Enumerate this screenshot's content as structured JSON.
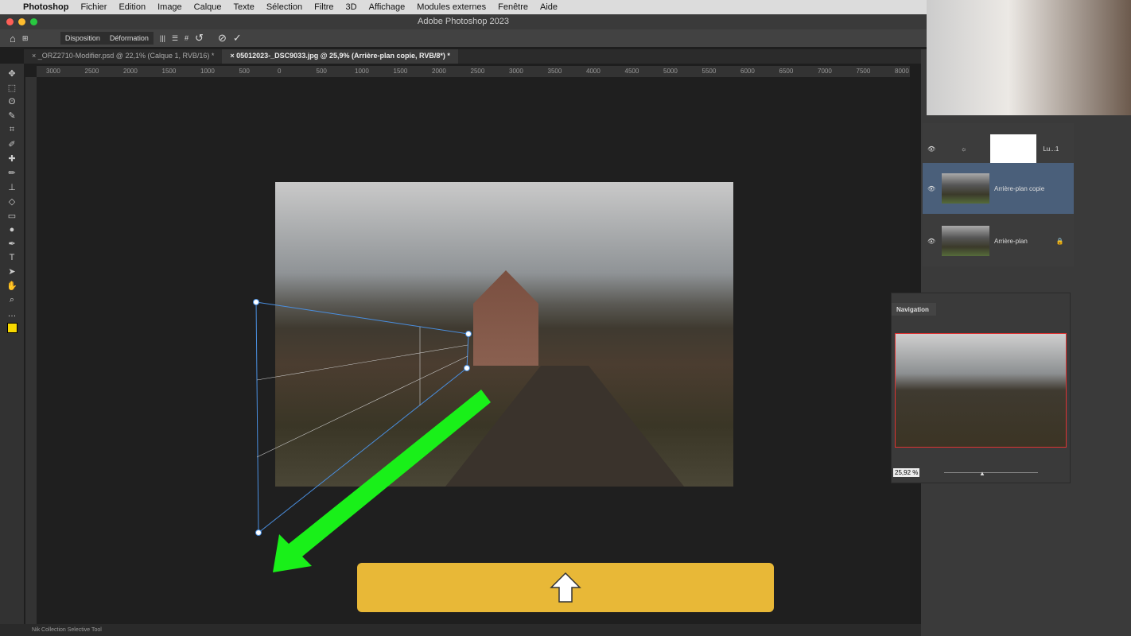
{
  "menubar": {
    "app": "Photoshop",
    "items": [
      "Fichier",
      "Edition",
      "Image",
      "Calque",
      "Texte",
      "Sélection",
      "Filtre",
      "3D",
      "Affichage",
      "Modules externes",
      "Fenêtre",
      "Aide"
    ]
  },
  "window": {
    "title": "Adobe Photoshop 2023"
  },
  "options": {
    "disposition": "Disposition",
    "deformation": "Déformation"
  },
  "tabs": [
    {
      "label": "_ORZ2710-Modifier.psd @ 22,1% (Calque 1, RVB/16) *"
    },
    {
      "label": "05012023-_DSC9033.jpg @ 25,9% (Arrière-plan copie, RVB/8*) *"
    }
  ],
  "ruler": [
    "3000",
    "2500",
    "2000",
    "1500",
    "1000",
    "500",
    "0",
    "500",
    "1000",
    "1500",
    "2000",
    "2500",
    "3000",
    "3500",
    "4000",
    "4500",
    "5000",
    "5500",
    "6000",
    "6500",
    "7000",
    "7500",
    "8000"
  ],
  "layers": [
    {
      "name": "Lu...1"
    },
    {
      "name": "Arrière-plan copie"
    },
    {
      "name": "Arrière-plan"
    }
  ],
  "navigation": {
    "title": "Navigation",
    "zoom": "25,92 %"
  },
  "status": "Nik Collection Selective Tool",
  "colors": {
    "accent_arrow": "#19f019",
    "banner": "#e8b837",
    "selected_layer": "#4a5f7a",
    "foreground": "#f7d800"
  }
}
